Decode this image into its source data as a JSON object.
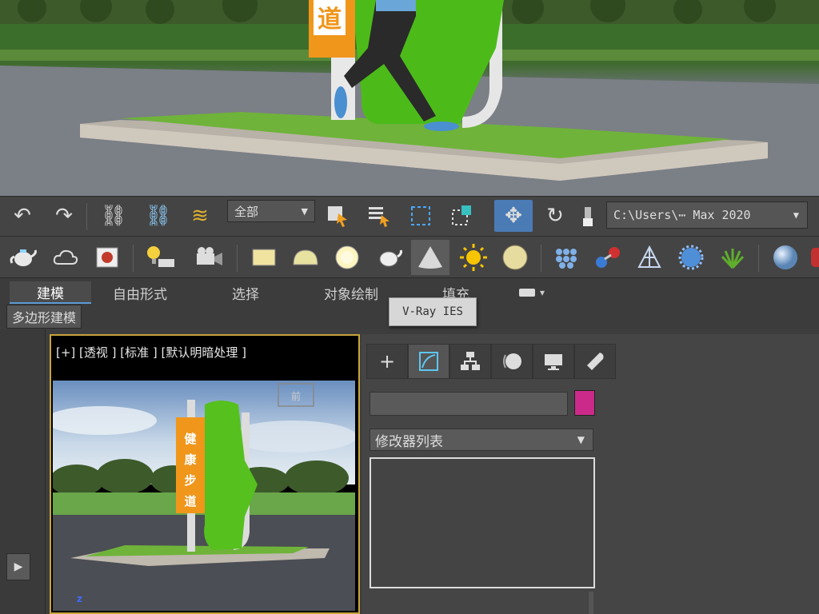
{
  "toolbar_main": {
    "selection_filter": "全部",
    "project_path": "C:\\Users\\⋯  Max 2020",
    "icons": [
      "undo-icon",
      "redo-icon",
      "link-icon",
      "unlink-icon",
      "bind-spacewarp-icon",
      "select-object-icon",
      "select-by-name-icon",
      "rect-selection-icon",
      "window-crossing-icon",
      "move-icon",
      "rotate-icon",
      "scale-icon"
    ]
  },
  "toolbar_vray": {
    "icons": [
      "teapot-icon",
      "cloud-icon",
      "render-frame-icon",
      "light-lister-icon",
      "camera-icon",
      "vray-plane-icon",
      "vray-dome-icon",
      "vray-sphere-light-icon",
      "vray-fur-teapot-icon",
      "vray-ies-icon",
      "vray-sun-icon",
      "vray-ambient-icon",
      "vray-proxy-icon",
      "vray-instancer-icon",
      "vray-pointcloud-icon",
      "vray-decal-icon",
      "vray-fur-icon",
      "vray-sphere-icon"
    ]
  },
  "ribbon": {
    "tabs": [
      "建模",
      "自由形式",
      "选择",
      "对象绘制",
      "填充"
    ],
    "subtab": "多边形建模",
    "tooltip": "V-Ray IES"
  },
  "viewport": {
    "label": "[+] [透视 ] [标准 ] [默认明暗处理 ]",
    "sign_text": "健康步道",
    "axis": "z"
  },
  "render_scene": {
    "sign_char": "道"
  },
  "command_panel": {
    "tabs": [
      "create-icon",
      "modify-icon",
      "hierarchy-icon",
      "motion-icon",
      "display-icon",
      "utilities-icon"
    ],
    "modifier_list": "修改器列表",
    "object_color": "#cc2a8a"
  }
}
